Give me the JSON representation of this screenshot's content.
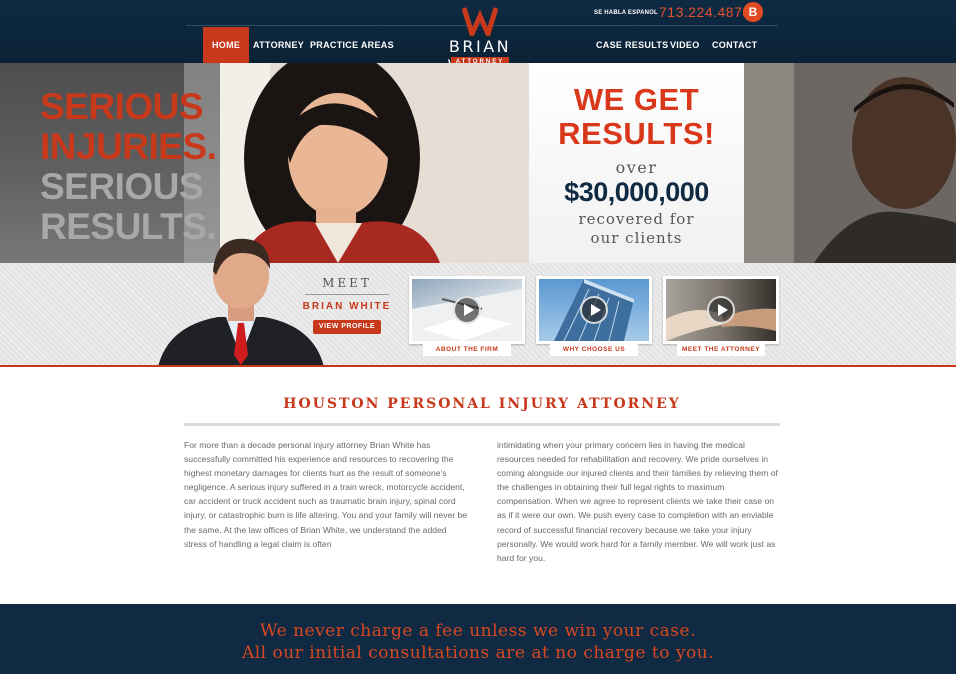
{
  "header": {
    "nav_left": [
      "HOME",
      "ATTORNEY",
      "PRACTICE AREAS"
    ],
    "nav_right": [
      "CASE RESULTS",
      "VIDEO",
      "CONTACT"
    ],
    "logo_name": "BRIAN WHITE",
    "logo_tag": "ATTORNEY",
    "habla": "SE HABLA ESPANOL",
    "phone": "713.224.4878",
    "badge": "B"
  },
  "hero": {
    "line1": "SERIOUS",
    "line2": "INJURIES.",
    "line3": "SERIOUS",
    "line4": "RESULTS.",
    "results_line1": "WE GET",
    "results_line2": "RESULTS!",
    "over": "over",
    "amount": "$30,000,000",
    "recovered_line1": "recovered for",
    "recovered_line2": "our clients"
  },
  "meet": {
    "label": "MEET",
    "name": "BRIAN WHITE",
    "button": "VIEW PROFILE",
    "thumbs": [
      {
        "label": "ABOUT THE FIRM"
      },
      {
        "label": "WHY CHOOSE US"
      },
      {
        "label": "MEET THE ATTORNEY"
      }
    ]
  },
  "content": {
    "heading": "HOUSTON PERSONAL INJURY ATTORNEY",
    "col1": "For more than a decade personal injury attorney Brian White has successfully committed his experience and resources to recovering the highest monetary damages for clients hurt as the result of someone’s negligence. A serious injury suffered in a train wreck, motorcycle accident, car accident or truck accident such as traumatic brain injury, spinal cord injury, or catastrophic burn is life altering. You and your family will never be the same. At the law offices of Brian White, we understand the added stress of handling a legal claim is often",
    "col2": "intimidating when your primary concern lies in having the medical resources needed for rehabilitation and recovery. We pride ourselves in coming alongside our injured clients and their families by relieving them of the challenges in obtaining their full legal rights to maximum compensation. When we agree to represent clients we take their case on as if it were our own. We push every case to completion with an enviable record of successful financial recovery because we take your injury personally. We would work hard for a family member. We will work just as hard for you."
  },
  "banner": {
    "line1": "We never charge a fee unless we win your case.",
    "line2": "All our initial consultations are at no charge to you."
  },
  "colors": {
    "accent": "#c8381b",
    "navy": "#0f2a42"
  }
}
